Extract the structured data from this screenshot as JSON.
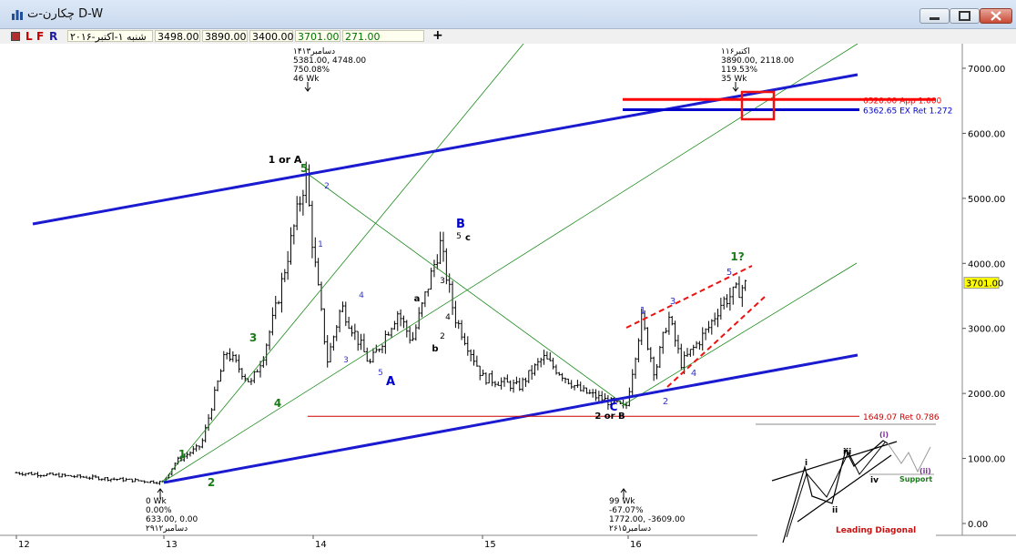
{
  "window": {
    "title": "چکارن-ت D-W",
    "icon": "chart-bar-icon",
    "buttons": {
      "minimize": "minimize-icon",
      "maximize": "maximize-icon",
      "close": "close-icon"
    }
  },
  "toolbar": {
    "letters": [
      "L",
      "F",
      "R"
    ],
    "date": "شنبه ۱-اکتبر-۲۰۱۶",
    "open": "3498.00",
    "high": "3890.00",
    "low": "3400.00",
    "close": "3701.00",
    "change": "271.00",
    "plus": "+"
  },
  "chart_data": {
    "type": "ohlc",
    "timeframe": "weekly",
    "x_labels": [
      "12",
      "13",
      "14",
      "15",
      "16"
    ],
    "y_ticks": [
      "7000.00",
      "6000.00",
      "5000.00",
      "4000.00",
      "3000.00",
      "2000.00",
      "1000.00",
      "0.00"
    ],
    "ylim": [
      -100,
      7500
    ],
    "last_price": "3701.00",
    "price_path_approx": [
      {
        "x": "2012-01",
        "y": 780
      },
      {
        "x": "2012-06",
        "y": 720
      },
      {
        "x": "2012-12-29",
        "y": 633
      },
      {
        "x": "2013-02",
        "y": 960
      },
      {
        "x": "2013-04",
        "y": 1200
      },
      {
        "x": "2013-06",
        "y": 2650
      },
      {
        "x": "2013-08",
        "y": 2150
      },
      {
        "x": "2013-09",
        "y": 2600
      },
      {
        "x": "2013-10",
        "y": 3300
      },
      {
        "x": "2013-12-14",
        "y": 5381
      },
      {
        "x": "2014-01",
        "y": 4200
      },
      {
        "x": "2014-02",
        "y": 2500
      },
      {
        "x": "2014-03",
        "y": 3350
      },
      {
        "x": "2014-05",
        "y": 2450
      },
      {
        "x": "2014-07",
        "y": 3250
      },
      {
        "x": "2014-08",
        "y": 2800
      },
      {
        "x": "2014-10",
        "y": 4300
      },
      {
        "x": "2014-11",
        "y": 3200
      },
      {
        "x": "2015-01",
        "y": 2250
      },
      {
        "x": "2015-04",
        "y": 2100
      },
      {
        "x": "2015-06",
        "y": 2550
      },
      {
        "x": "2015-09",
        "y": 2050
      },
      {
        "x": "2015-12-26",
        "y": 1772
      },
      {
        "x": "2016-02",
        "y": 3150
      },
      {
        "x": "2016-03",
        "y": 2300
      },
      {
        "x": "2016-04",
        "y": 3200
      },
      {
        "x": "2016-05",
        "y": 2450
      },
      {
        "x": "2016-07",
        "y": 3000
      },
      {
        "x": "2016-08",
        "y": 3400
      },
      {
        "x": "2016-10-01",
        "y": 3701
      }
    ],
    "horizontal_levels": [
      {
        "price": 6520.0,
        "label": "6520.00 App 1.000",
        "color": "#ff0000"
      },
      {
        "price": 6362.65,
        "label": "6362.65 EX Ret 1.272",
        "color": "#0000cc"
      },
      {
        "price": 1649.07,
        "label": "1649.07 Ret 0.786",
        "color": "#cc0000"
      }
    ],
    "info_boxes": [
      {
        "name": "peak-2013",
        "lines": [
          "۱۴دسامبر۱۳",
          "5381.00, 4748.00",
          "750.08%",
          "46 Wk"
        ]
      },
      {
        "name": "current-2016",
        "lines": [
          "۱اکتبر۱۶",
          "3890.00, 2118.00",
          "119.53%",
          "35 Wk"
        ]
      },
      {
        "name": "start-2012",
        "lines": [
          "0 Wk",
          "0.00%",
          "633.00, 0.00",
          "۲۹دسامبر۱۲"
        ]
      },
      {
        "name": "low-2015",
        "lines": [
          "99 Wk",
          "-67.07%",
          "1772.00, -3609.00",
          "۲۶دسامبر۱۵"
        ]
      }
    ],
    "wave_labels": [
      {
        "text": "1",
        "color": "#1a7a1a"
      },
      {
        "text": "2",
        "color": "#1a7a1a"
      },
      {
        "text": "3",
        "color": "#1a7a1a"
      },
      {
        "text": "4",
        "color": "#1a7a1a"
      },
      {
        "text": "5",
        "color": "#1a7a1a"
      },
      {
        "text": "1 or A",
        "color": "#000000"
      },
      {
        "text": "A",
        "color": "#0000cc"
      },
      {
        "text": "B",
        "color": "#0000cc"
      },
      {
        "text": "C",
        "color": "#0000cc"
      },
      {
        "text": "2 or B",
        "color": "#000000"
      },
      {
        "text": "1?",
        "color": "#1a7a1a"
      },
      {
        "text": "a",
        "color": "#000000"
      },
      {
        "text": "b",
        "color": "#000000"
      },
      {
        "text": "c",
        "color": "#000000"
      },
      {
        "text": "1",
        "color": "#3333cc"
      },
      {
        "text": "2",
        "color": "#3333cc"
      },
      {
        "text": "3",
        "color": "#3333cc"
      },
      {
        "text": "4",
        "color": "#3333cc"
      },
      {
        "text": "5",
        "color": "#3333cc"
      }
    ],
    "inset": {
      "labels": [
        "i",
        "ii",
        "iii",
        "iv",
        "(i)",
        "(ii)",
        "Support"
      ],
      "caption": "Leading Diagonal"
    }
  }
}
